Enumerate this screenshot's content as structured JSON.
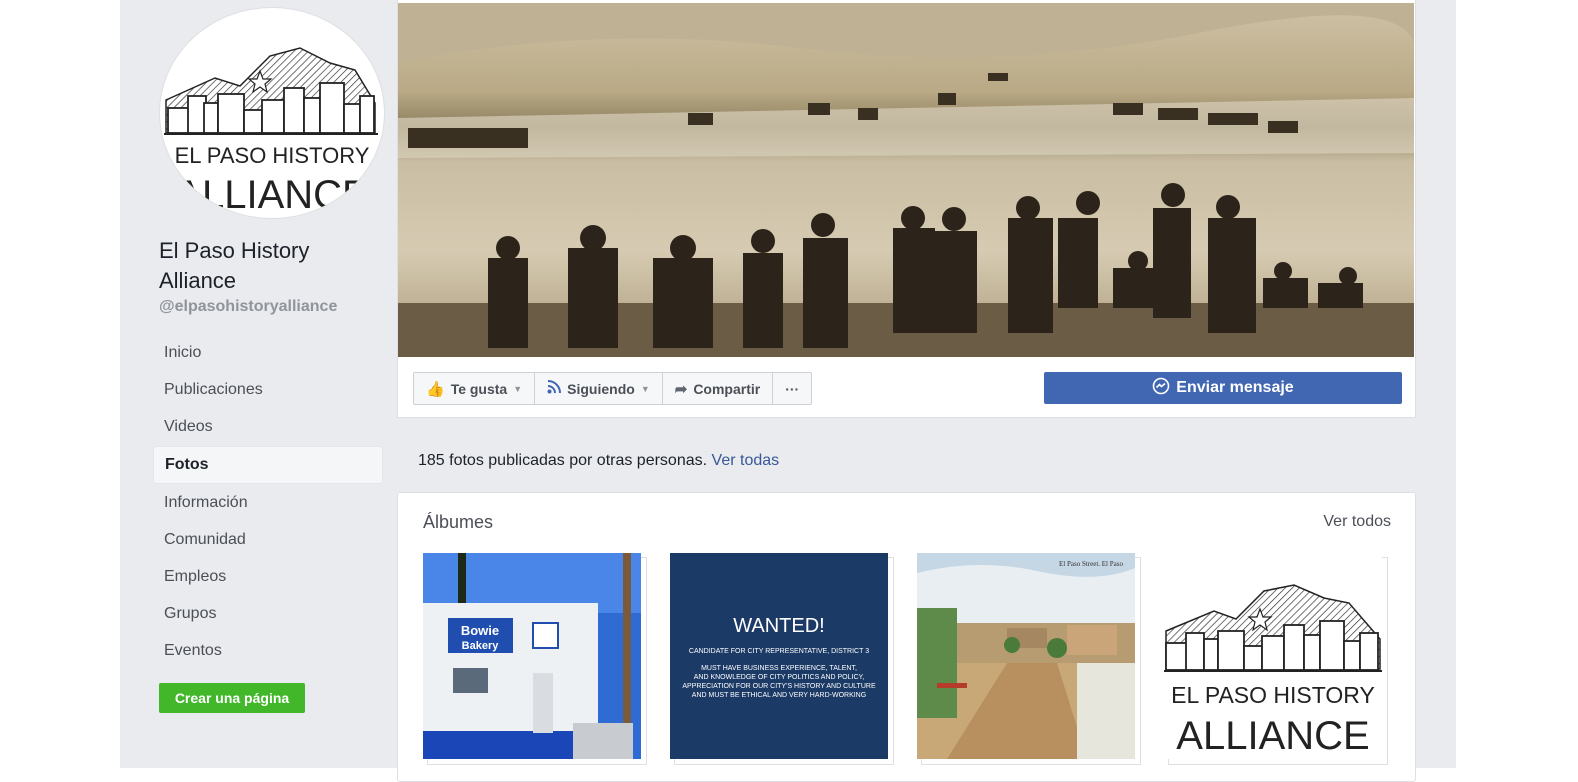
{
  "page": {
    "name": "El Paso History Alliance",
    "handle": "@elpasohistoryalliance",
    "logo_text_line1": "EL PASO HISTORY",
    "logo_text_line2": "ALLIANCE"
  },
  "nav": {
    "items": [
      "Inicio",
      "Publicaciones",
      "Videos",
      "Fotos",
      "Información",
      "Comunidad",
      "Empleos",
      "Grupos",
      "Eventos"
    ],
    "active": "Fotos",
    "create_page": "Crear una página"
  },
  "actions": {
    "like": "Te gusta",
    "follow": "Siguiendo",
    "share": "Compartir",
    "more": "···",
    "message": "Enviar mensaje"
  },
  "photos": {
    "text": "185 fotos publicadas por otras personas.",
    "link": "Ver todas"
  },
  "albums": {
    "title": "Álbumes",
    "see_all": "Ver todos",
    "items": [
      {
        "kind": "bakery-photo",
        "sign_line1": "Bowie",
        "sign_line2": "Bakery"
      },
      {
        "kind": "wanted-poster",
        "heading": "WANTED!",
        "line1": "CANDIDATE FOR CITY REPRESENTATIVE, DISTRICT 3",
        "line2": "MUST HAVE BUSINESS EXPERIENCE, TALENT,",
        "line3": "AND KNOWLEDGE OF CITY POLITICS AND POLICY,",
        "line4": "APPRECIATION FOR OUR CITY'S HISTORY AND CULTURE",
        "line5": "AND MUST BE ETHICAL AND VERY HARD-WORKING"
      },
      {
        "kind": "postcard",
        "caption": "El Paso Street. El Paso"
      },
      {
        "kind": "logo"
      }
    ]
  },
  "colors": {
    "accent": "#4267b2",
    "link": "#385898",
    "create_green": "#42b72a",
    "page_bg": "#e9ebee"
  }
}
